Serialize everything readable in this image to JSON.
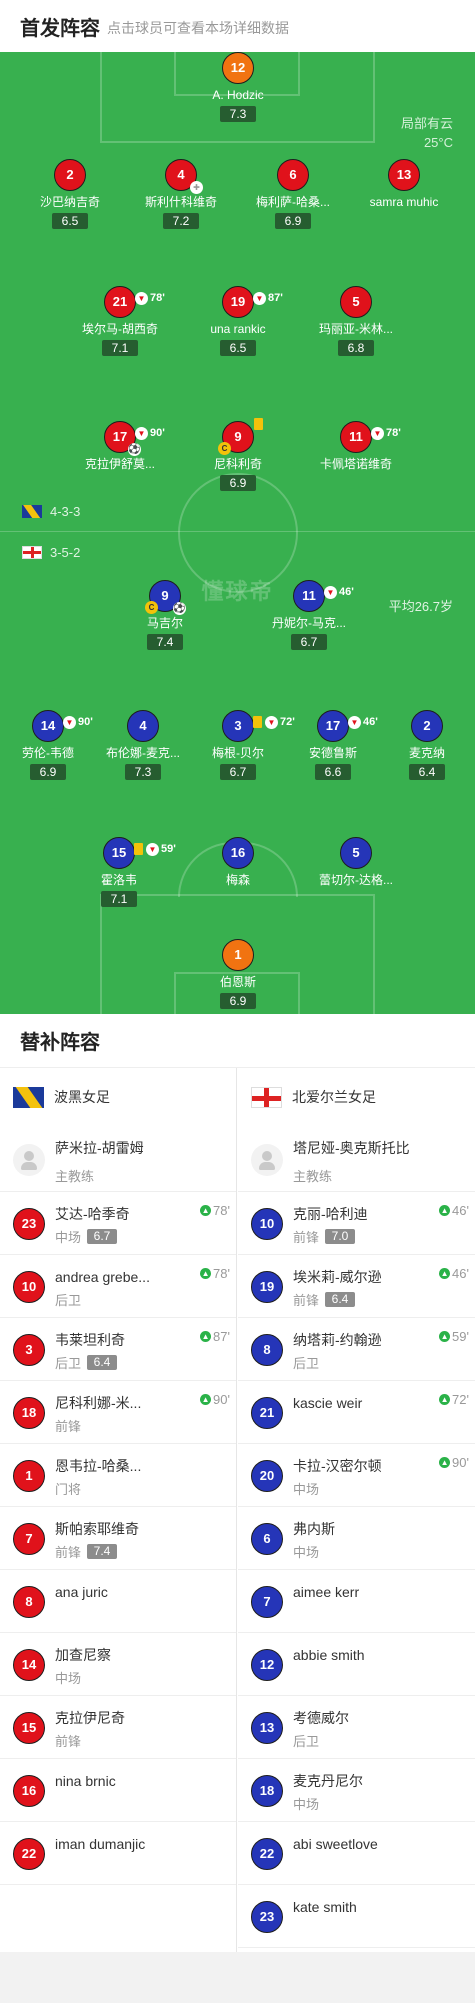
{
  "header": {
    "title": "首发阵容",
    "subtitle": "点击球员可查看本场详细数据"
  },
  "weather": {
    "line1": "局部有云",
    "line2": "25°C"
  },
  "home_form": {
    "formation": "4-3-3"
  },
  "away_form": {
    "formation": "3-5-2",
    "avg_age": "平均26.7岁"
  },
  "pitch_logo": "懂球帝",
  "colors": {
    "pitch": "#38b04f",
    "home": "#e0121b",
    "away": "#2535b8",
    "keeper": "#f17311"
  },
  "home_players": [
    {
      "num": "12",
      "name": "A. Hodzic",
      "rating": "7.3",
      "color": "orange"
    },
    {
      "num": "2",
      "name": "沙巴纳吉奇",
      "rating": "6.5",
      "color": "red"
    },
    {
      "num": "4",
      "name": "斯利什科维奇",
      "rating": "7.2",
      "color": "red"
    },
    {
      "num": "6",
      "name": "梅利萨-哈桑...",
      "rating": "6.9",
      "color": "red"
    },
    {
      "num": "13",
      "name": "samra muhic",
      "rating": "",
      "color": "red"
    },
    {
      "num": "21",
      "name": "埃尔马-胡西奇",
      "rating": "7.1",
      "color": "red",
      "sub": "78'"
    },
    {
      "num": "19",
      "name": "una rankic",
      "rating": "6.5",
      "color": "red",
      "sub": "87'"
    },
    {
      "num": "5",
      "name": "玛丽亚-米林...",
      "rating": "6.8",
      "color": "red"
    },
    {
      "num": "17",
      "name": "克拉伊舒莫...",
      "rating": "",
      "color": "red",
      "sub": "90'"
    },
    {
      "num": "9",
      "name": "尼科利奇",
      "rating": "6.9",
      "color": "red"
    },
    {
      "num": "11",
      "name": "卡佩塔诺维奇",
      "rating": "",
      "color": "red",
      "sub": "78'"
    }
  ],
  "away_players": [
    {
      "num": "9",
      "name": "马吉尔",
      "rating": "7.4",
      "color": "blue"
    },
    {
      "num": "11",
      "name": "丹妮尔-马克...",
      "rating": "6.7",
      "color": "blue",
      "sub": "46'"
    },
    {
      "num": "14",
      "name": "劳伦-韦德",
      "rating": "6.9",
      "color": "blue",
      "sub": "90'"
    },
    {
      "num": "4",
      "name": "布伦娜-麦克...",
      "rating": "7.3",
      "color": "blue"
    },
    {
      "num": "3",
      "name": "梅根-贝尔",
      "rating": "6.7",
      "color": "blue",
      "sub": "72'"
    },
    {
      "num": "17",
      "name": "安德鲁斯",
      "rating": "6.6",
      "color": "blue",
      "sub": "46'"
    },
    {
      "num": "2",
      "name": "麦克纳",
      "rating": "6.4",
      "color": "blue"
    },
    {
      "num": "15",
      "name": "霍洛韦",
      "rating": "7.1",
      "color": "blue",
      "sub": "59'"
    },
    {
      "num": "16",
      "name": "梅森",
      "rating": "",
      "color": "blue"
    },
    {
      "num": "5",
      "name": "蕾切尔-达格...",
      "rating": "",
      "color": "blue"
    },
    {
      "num": "1",
      "name": "伯恩斯",
      "rating": "6.9",
      "color": "orange"
    }
  ],
  "subs_title": "替补阵容",
  "home_team": {
    "name": "波黑女足",
    "coach": "萨米拉-胡雷姆",
    "coach_role": "主教练",
    "subs": [
      {
        "num": "23",
        "name": "艾达-哈季奇",
        "pos": "中场",
        "rating": "6.7",
        "min": "78'"
      },
      {
        "num": "10",
        "name": "andrea grebe...",
        "pos": "后卫",
        "rating": "",
        "min": "78'"
      },
      {
        "num": "3",
        "name": "韦莱坦利奇",
        "pos": "后卫",
        "rating": "6.4",
        "min": "87'"
      },
      {
        "num": "18",
        "name": "尼科利娜-米...",
        "pos": "前锋",
        "rating": "",
        "min": "90'"
      },
      {
        "num": "1",
        "name": "恩韦拉-哈桑...",
        "pos": "门将",
        "rating": "",
        "min": ""
      },
      {
        "num": "7",
        "name": "斯帕索耶维奇",
        "pos": "前锋",
        "rating": "7.4",
        "min": ""
      },
      {
        "num": "8",
        "name": "ana juric",
        "pos": "",
        "rating": "",
        "min": ""
      },
      {
        "num": "14",
        "name": "加查尼察",
        "pos": "中场",
        "rating": "",
        "min": ""
      },
      {
        "num": "15",
        "name": "克拉伊尼奇",
        "pos": "前锋",
        "rating": "",
        "min": ""
      },
      {
        "num": "16",
        "name": "nina brnic",
        "pos": "",
        "rating": "",
        "min": ""
      },
      {
        "num": "22",
        "name": "iman dumanjic",
        "pos": "",
        "rating": "",
        "min": ""
      }
    ]
  },
  "away_team": {
    "name": "北爱尔兰女足",
    "coach": "塔尼娅-奥克斯托比",
    "coach_role": "主教练",
    "subs": [
      {
        "num": "10",
        "name": "克丽-哈利迪",
        "pos": "前锋",
        "rating": "7.0",
        "min": "46'"
      },
      {
        "num": "19",
        "name": "埃米莉-威尔逊",
        "pos": "前锋",
        "rating": "6.4",
        "min": "46'"
      },
      {
        "num": "8",
        "name": "纳塔莉-约翰逊",
        "pos": "后卫",
        "rating": "",
        "min": "59'"
      },
      {
        "num": "21",
        "name": "kascie weir",
        "pos": "",
        "rating": "",
        "min": "72'"
      },
      {
        "num": "20",
        "name": "卡拉-汉密尔顿",
        "pos": "中场",
        "rating": "",
        "min": "90'"
      },
      {
        "num": "6",
        "name": "弗内斯",
        "pos": "中场",
        "rating": "",
        "min": ""
      },
      {
        "num": "7",
        "name": "aimee kerr",
        "pos": "",
        "rating": "",
        "min": ""
      },
      {
        "num": "12",
        "name": "abbie smith",
        "pos": "",
        "rating": "",
        "min": ""
      },
      {
        "num": "13",
        "name": "考德威尔",
        "pos": "后卫",
        "rating": "",
        "min": ""
      },
      {
        "num": "18",
        "name": "麦克丹尼尔",
        "pos": "中场",
        "rating": "",
        "min": ""
      },
      {
        "num": "22",
        "name": "abi sweetlove",
        "pos": "",
        "rating": "",
        "min": ""
      },
      {
        "num": "23",
        "name": "kate smith",
        "pos": "",
        "rating": "",
        "min": ""
      }
    ]
  }
}
